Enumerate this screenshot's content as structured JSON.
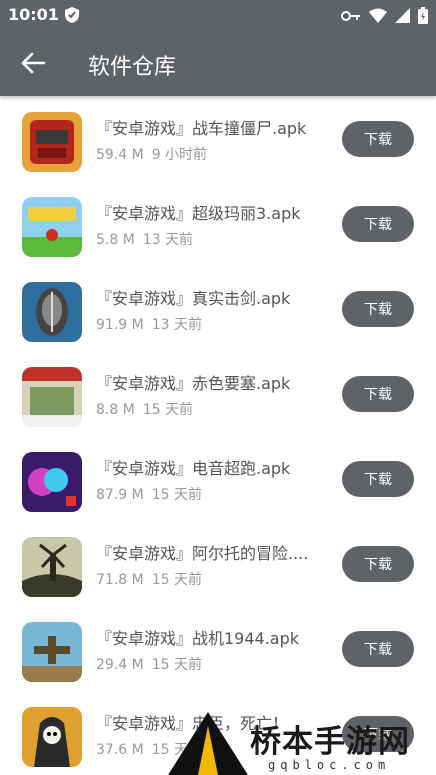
{
  "status_bar": {
    "time": "10:01"
  },
  "app_bar": {
    "title": "软件仓库"
  },
  "items": [
    {
      "name": "『安卓游戏』战车撞僵尸.apk",
      "size": "59.4 M",
      "age": "9 小时前",
      "button": "下载"
    },
    {
      "name": "『安卓游戏』超级玛丽3.apk",
      "size": "5.8 M",
      "age": "13 天前",
      "button": "下载"
    },
    {
      "name": "『安卓游戏』真实击剑.apk",
      "size": "91.9 M",
      "age": "13 天前",
      "button": "下载"
    },
    {
      "name": "『安卓游戏』赤色要塞.apk",
      "size": "8.8 M",
      "age": "15 天前",
      "button": "下载"
    },
    {
      "name": "『安卓游戏』电音超跑.apk",
      "size": "87.9 M",
      "age": "15 天前",
      "button": "下载"
    },
    {
      "name": "『安卓游戏』阿尔托的冒险....",
      "size": "71.8 M",
      "age": "15 天前",
      "button": "下载"
    },
    {
      "name": "『安卓游戏』战机1944.apk",
      "size": "29.4 M",
      "age": "15 天前",
      "button": "下载"
    },
    {
      "name": "『安卓游戏』忠臣，死亡！",
      "size": "37.6 M",
      "age": "15 天前",
      "button": "下载"
    }
  ],
  "watermark": {
    "brand": "桥本手游网",
    "site": "gqbloc.com"
  },
  "colors": {
    "bar": "#5f6368",
    "button": "#5f6368",
    "accent": "#f5b800"
  }
}
